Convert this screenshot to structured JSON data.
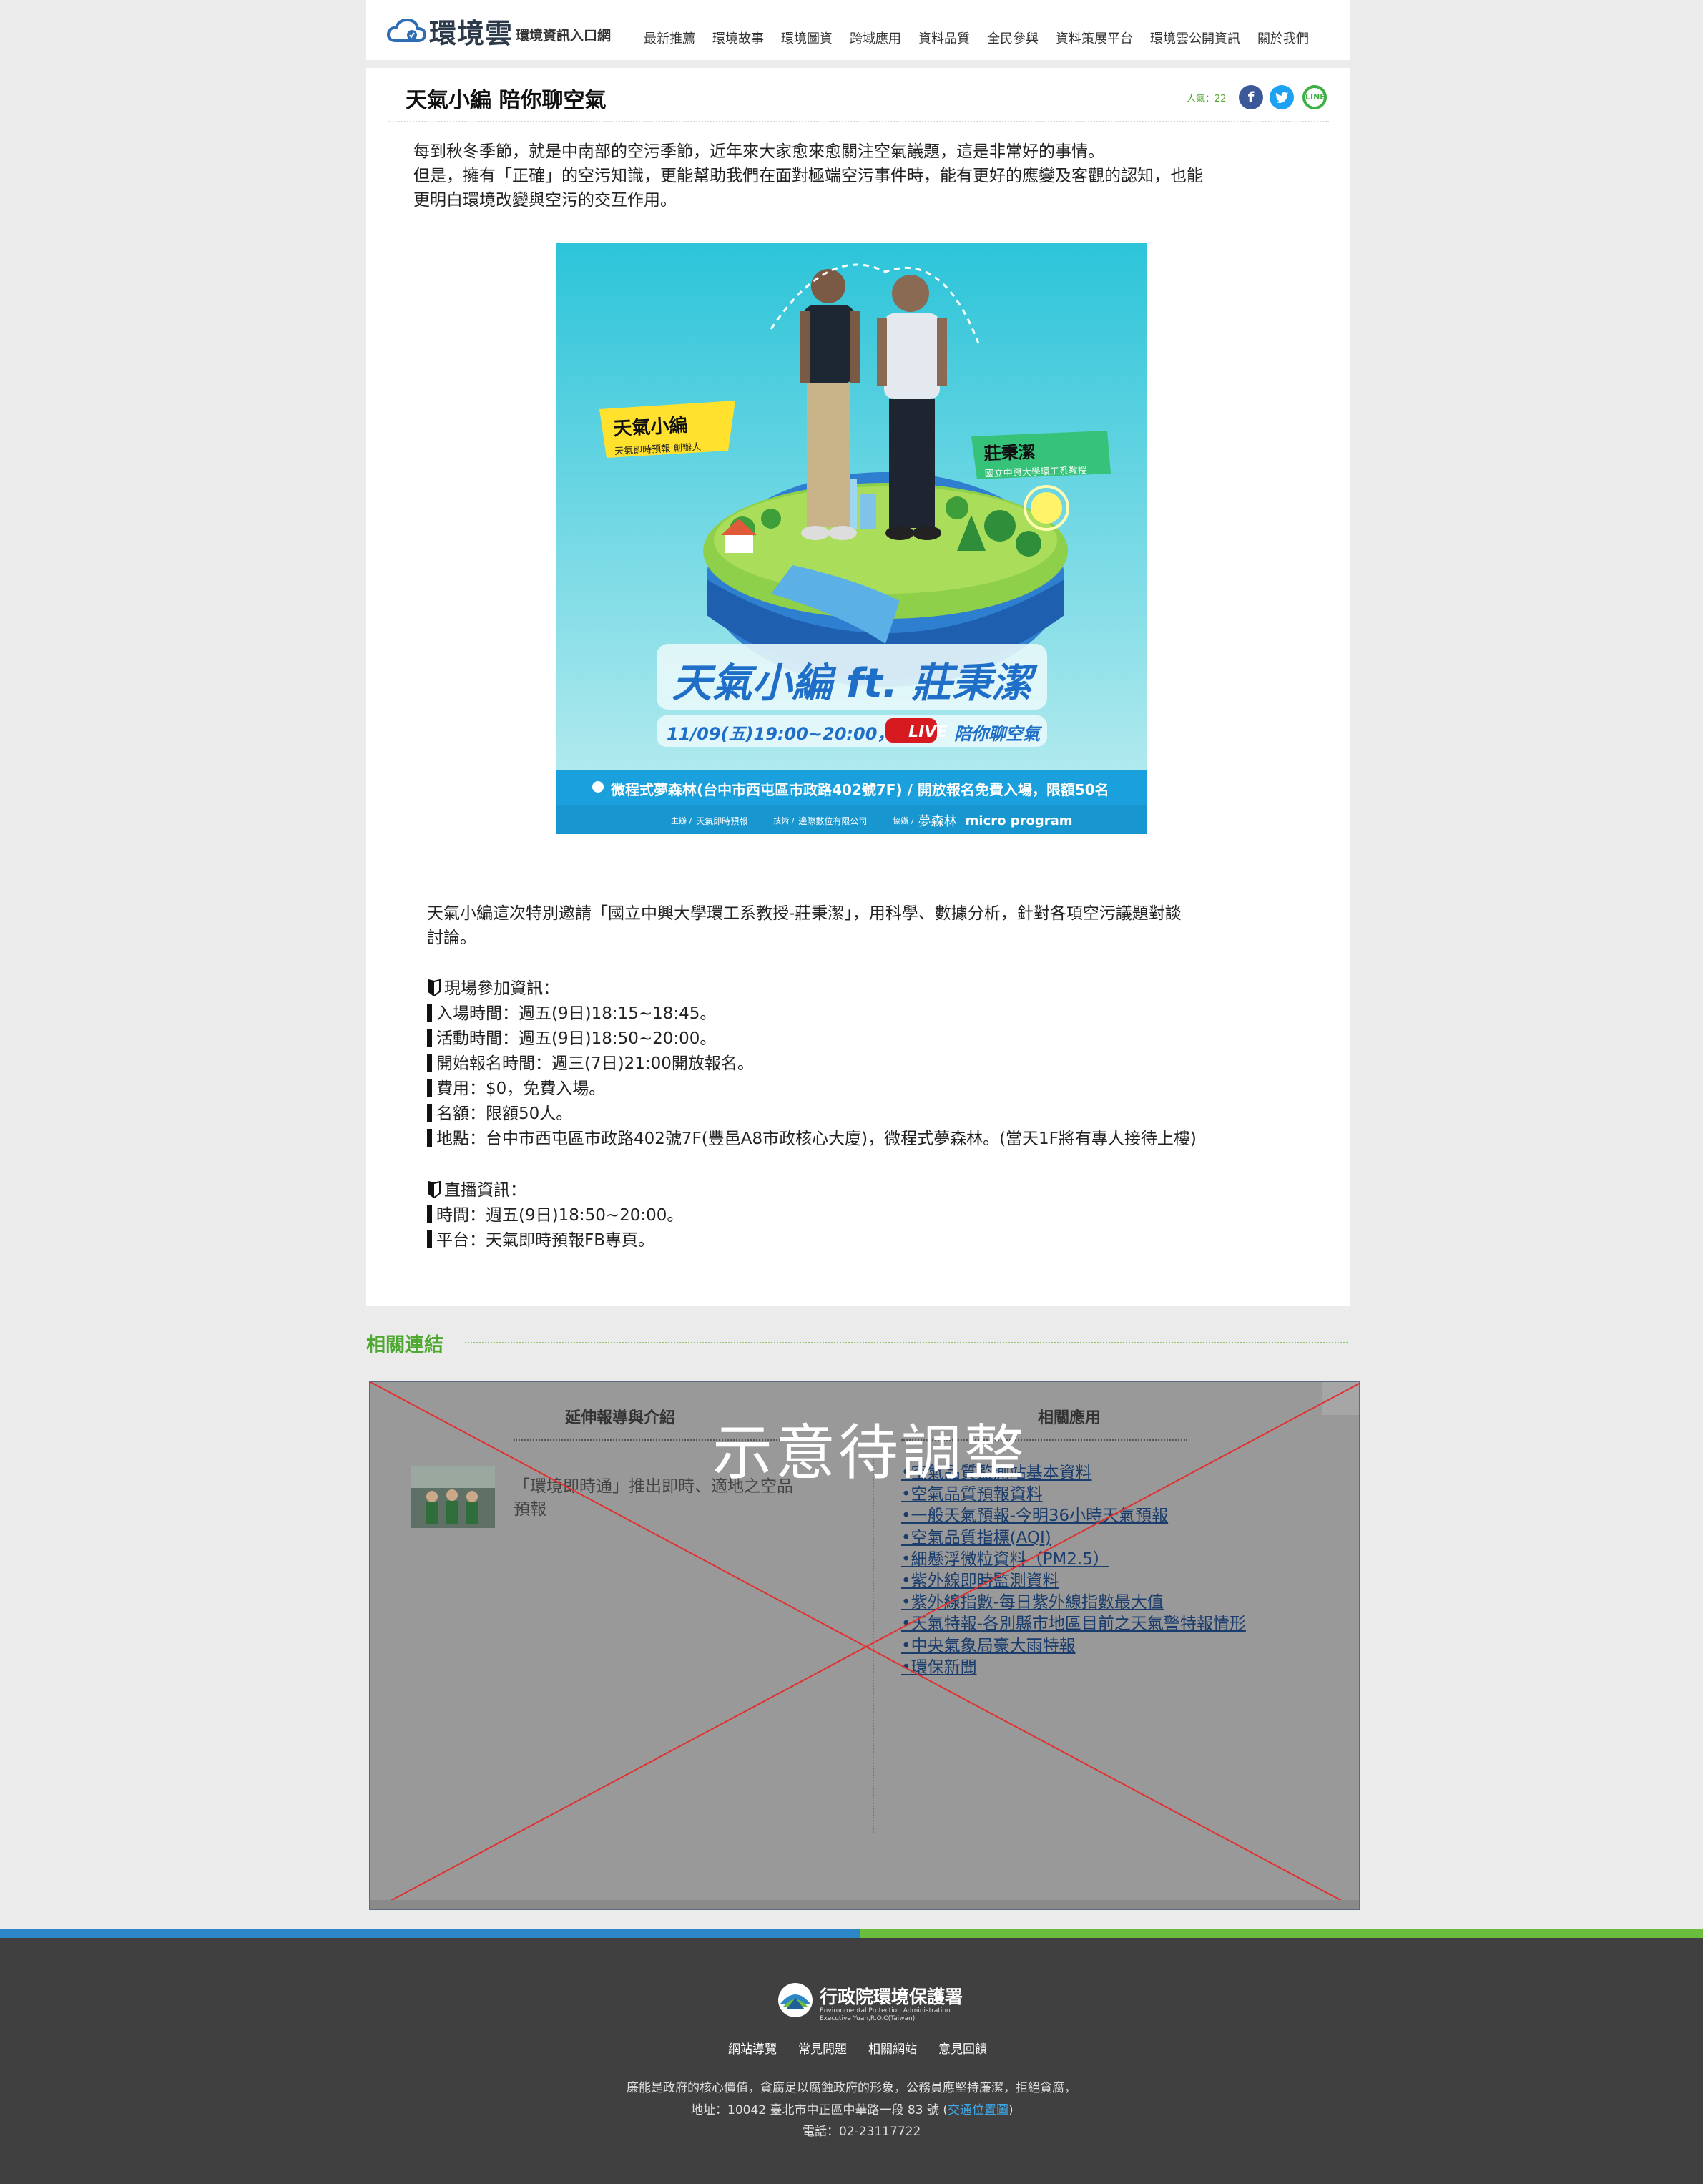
{
  "header": {
    "logo_main": "環境雲",
    "logo_sub": "環境資訊入口網",
    "nav": [
      "最新推薦",
      "環境故事",
      "環境圖資",
      "跨域應用",
      "資料品質",
      "全民參與",
      "資料策展平台",
      "環境雲公開資訊",
      "關於我們"
    ]
  },
  "article": {
    "title": "天氣小編 陪你聊空氣",
    "popularity": "人氣：22",
    "share": {
      "facebook": "f",
      "twitter": "t",
      "line": "LINE"
    },
    "intro": [
      "每到秋冬季節，就是中南部的空污季節，近年來大家愈來愈關注空氣議題，這是非常好的事情。",
      "但是，擁有「正確」的空污知識，更能幫助我們在面對極端空污事件時，能有更好的應變及客觀的認知，也能",
      "更明白環境改變與空污的交互作用。"
    ],
    "poster": {
      "tag_left_title": "天氣小編",
      "tag_left_sub": "天氣即時預報 創辦人",
      "tag_right_title": "莊秉潔",
      "tag_right_sub": "國立中興大學環工系教授",
      "headline": "天氣小編 ft. 莊秉潔",
      "time": "11/09(五)19:00~20:00，",
      "live": "LIVE",
      "topic": "陪你聊空氣",
      "venue": "微程式夢森林(台中市西屯區市政路402號7F)  /  開放報名免費入場，限額50名",
      "sponsor_host": "主辦 /",
      "sponsor_host_name": "天氣即時預報",
      "sponsor_tech": "技術 /",
      "sponsor_tech_name": "邊際數位有限公司",
      "sponsor_assist": "協辦 /",
      "sponsor_assist_name1": "夢森林",
      "sponsor_assist_name2": "micro program"
    },
    "body": [
      "天氣小編這次特別邀請「國立中興大學環工系教授-莊秉潔」，用科學、數據分析，針對各項空污議題對談",
      "討論。"
    ],
    "onsite_heading": "現場參加資訊：",
    "onsite_items": [
      "入場時間：週五(9日)18:15~18:45。",
      "活動時間：週五(9日)18:50~20:00。",
      "開始報名時間：週三(7日)21:00開放報名。",
      "費用：$0，免費入場。",
      "名額：限額50人。",
      "地點：台中市西屯區市政路402號7F(豐邑A8市政核心大廈)，微程式夢森林。(當天1F將有專人接待上樓)"
    ],
    "live_heading": "直播資訊：",
    "live_items": [
      "時間：週五(9日)18:50~20:00。",
      "平台：天氣即時預報FB專頁。"
    ]
  },
  "related": {
    "title": "相關連結",
    "col_left": "延伸報導與介紹",
    "col_right": "相關應用",
    "placeholder": "示意待調整",
    "news_lines": [
      "「環境即時通」推出即時、適地之空品",
      "預報"
    ],
    "links": [
      "•空氣品質監測站基本資料",
      "•空氣品質預報資料",
      "•一般天氣預報-今明36小時天氣預報",
      "•空氣品質指標(AQI)",
      "•細懸浮微粒資料（PM2.5）",
      "•紫外線即時監測資料",
      "•紫外線指數-每日紫外線指數最大值",
      "•天氣特報-各別縣市地區目前之天氣警特報情形",
      "•中央氣象局豪大雨特報",
      "•環保新聞"
    ]
  },
  "footer": {
    "org_name": "行政院環境保護署",
    "org_en1": "Environmental Protection Administration",
    "org_en2": "Executive Yuan,R.O.C(Taiwan)",
    "links": [
      "網站導覽",
      "常見問題",
      "相關網站",
      "意見回饋"
    ],
    "slogan": "廉能是政府的核心價值，貪腐足以腐蝕政府的形象，公務員應堅持廉潔，拒絕貪腐，",
    "address_prefix": "地址：10042 臺北市中正區中華路一段 83 號 (",
    "map_link": "交通位置圖",
    "address_suffix": ")",
    "phone": "電話：02-23117722"
  },
  "colors": {
    "accent_green": "#4fa831",
    "stripe_blue": "#2c86c8",
    "stripe_green": "#6bbd3e",
    "footer_bg": "#404040",
    "link": "#1a3d6d"
  }
}
